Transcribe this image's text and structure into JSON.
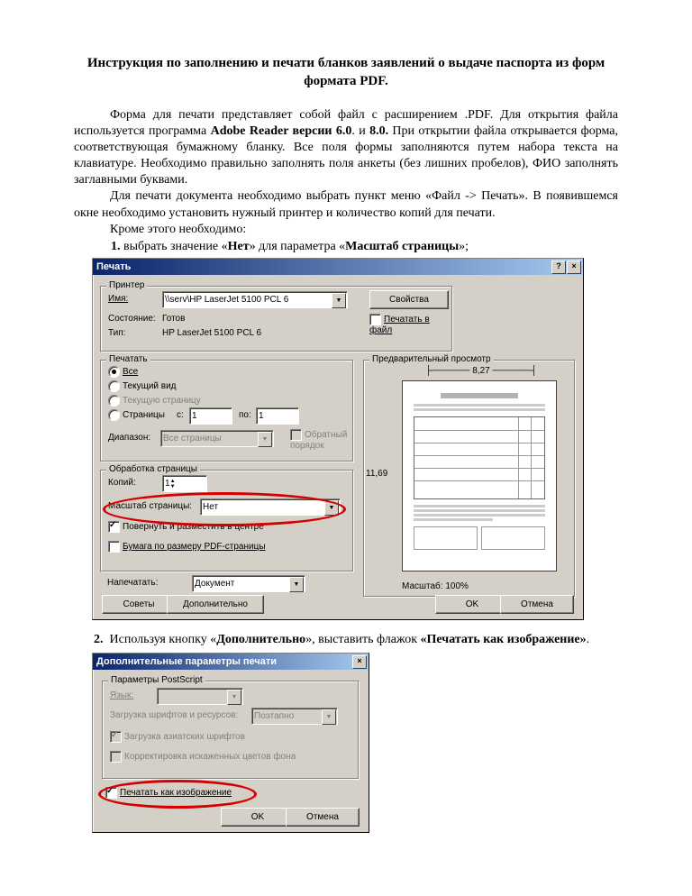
{
  "title": "Инструкция по заполнению и печати бланков заявлений о выдаче паспорта из форм формата PDF.",
  "para1_a": "Форма для печати представляет собой файл с расширением .PDF. Для открытия файла используется программа ",
  "para1_b": "Adobe Reader версии 6.0",
  "para1_c": ". и ",
  "para1_d": "8.0.",
  "para1_e": " При открытии файла открывается форма, соответствующая бумажному бланку. Все поля формы заполняются путем набора текста на клавиатуре. Необходимо правильно заполнять поля анкеты (без лишних пробелов), ФИО заполнять заглавными буквами.",
  "para2": "Для печати документа необходимо выбрать пункт меню «Файл -> Печать». В появившемся окне необходимо установить нужный принтер и количество копий для печати.",
  "para3": "Кроме этого необходимо:",
  "li1_a": "выбрать значение «",
  "li1_b": "Нет",
  "li1_c": "» для параметра «",
  "li1_d": "Масштаб страницы",
  "li1_e": "»;",
  "step2_a": "2.",
  "step2_b": "Используя кнопку «",
  "step2_c": "Дополнительно",
  "step2_d": "», выставить флажок ",
  "step2_e": "«Печатать как изображение»",
  "step2_f": ".",
  "dlg1": {
    "title": "Печать",
    "help": "?",
    "close": "×",
    "grp_printer": "Принтер",
    "name_lbl": "Имя:",
    "name_val": "\\\\serv\\HP LaserJet 5100 PCL 6",
    "state_lbl": "Состояние:",
    "state_val": "Готов",
    "type_lbl": "Тип:",
    "type_val": "HP LaserJet 5100 PCL 6",
    "props": "Свойства",
    "print_to_file": "Печатать в файл",
    "grp_range": "Печатать",
    "r_all": "Все",
    "r_curview": "Текущий вид",
    "r_curpage": "Текущую страницу",
    "r_pages": "Страницы",
    "r_from": "с:",
    "r_from_v": "1",
    "r_to": "по:",
    "r_to_v": "1",
    "diap_lbl": "Диапазон:",
    "diap_val": "Все страницы",
    "rev": "Обратный порядок",
    "grp_page": "Обработка страницы",
    "copies_lbl": "Копий:",
    "copies_val": "1",
    "scale_lbl": "Масштаб страницы:",
    "scale_val": "Нет",
    "rotate": "Повернуть и разместить в центре",
    "pdfsize": "Бумага по размеру PDF-страницы",
    "print_lbl": "Напечатать:",
    "print_val": "Документ",
    "grp_preview": "Предварительный просмотр",
    "pv_w": "8,27",
    "pv_h": "11,69",
    "pv_zoom": "Масштаб: 100%",
    "tips": "Советы",
    "adv": "Дополнительно",
    "ok": "OK",
    "cancel": "Отмена"
  },
  "dlg2": {
    "title": "Дополнительные параметры печати",
    "close": "×",
    "grp_ps": "Параметры PostScript",
    "lang_lbl": "Язык:",
    "fonts_lbl": "Загрузка шрифтов и ресурсов:",
    "fonts_val": "Поэтапно",
    "asian": "Загрузка азиатских шрифтов",
    "bgfix": "Корректировка искаженных цветов фона",
    "asimg": "Печатать как изображение",
    "ok": "OK",
    "cancel": "Отмена"
  }
}
